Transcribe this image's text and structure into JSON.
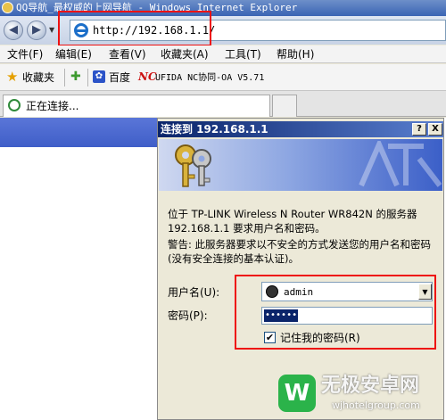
{
  "window": {
    "title": "QQ导航_最权威的上网导航 - Windows Internet Explorer"
  },
  "nav": {
    "address": "http://192.168.1.1/"
  },
  "menu": {
    "items": [
      "文件(F)",
      "编辑(E)",
      "查看(V)",
      "收藏夹(A)",
      "工具(T)",
      "帮助(H)"
    ]
  },
  "favorites": {
    "label": "收藏夹",
    "links": [
      "百度",
      "UFIDA NC协同-OA V5.71"
    ],
    "nc_logo": "NC"
  },
  "tab": {
    "label": "正在连接..."
  },
  "dialog": {
    "title": "连接到 192.168.1.1",
    "help_label": "?",
    "close_label": "X",
    "message": "位于 TP-LINK Wireless N Router WR842N 的服务器 192.168.1.1 要求用户名和密码。",
    "warning": "警告: 此服务器要求以不安全的方式发送您的用户名和密码(没有安全连接的基本认证)。",
    "username_label": "用户名(U):",
    "username_value": "admin",
    "password_label": "密码(P):",
    "password_value": "••••••",
    "remember_label": "记住我的密码(R)",
    "remember_checked": "✔"
  },
  "watermark": {
    "name": "无极安卓网",
    "url": "wjhotelgroup.com",
    "logo": "W"
  },
  "colors": {
    "highlight": "#ee1111",
    "titlebar": "#0a246a"
  }
}
